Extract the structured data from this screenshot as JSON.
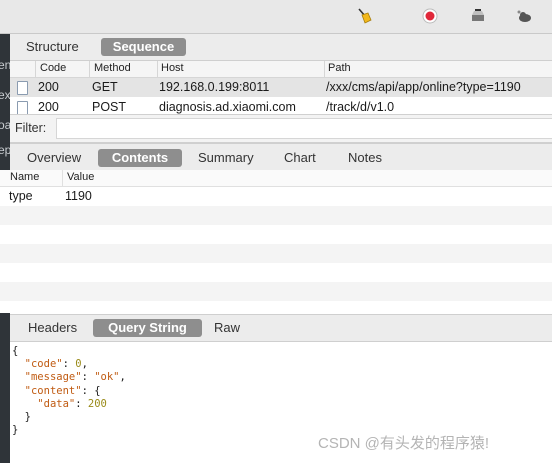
{
  "left_fragments": [
    "en",
    "ex",
    "oa",
    "ep",
    "e"
  ],
  "toolbar": {
    "icons": [
      "broom-icon",
      "record-icon",
      "throttle-icon",
      "settings-cloud-icon"
    ]
  },
  "view_tabs": {
    "items": [
      "Structure",
      "Sequence"
    ],
    "active": "Sequence"
  },
  "requests": {
    "columns": [
      "Code",
      "Method",
      "Host",
      "Path"
    ],
    "rows": [
      {
        "code": "200",
        "method": "GET",
        "host": "192.168.0.199:8011",
        "path": "/xxx/cms/api/app/online?type=1190"
      },
      {
        "code": "200",
        "method": "POST",
        "host": "diagnosis.ad.xiaomi.com",
        "path": "/track/d/v1.0"
      }
    ]
  },
  "filter": {
    "label": "Filter:",
    "value": ""
  },
  "detail_tabs": {
    "items": [
      "Overview",
      "Contents",
      "Summary",
      "Chart",
      "Notes"
    ],
    "active": "Contents"
  },
  "params": {
    "columns": [
      "Name",
      "Value"
    ],
    "rows": [
      {
        "name": "type",
        "value": "1190"
      }
    ]
  },
  "response_tabs": {
    "items": [
      "Headers",
      "Query String",
      "Raw"
    ],
    "active": "Query String"
  },
  "json_body": {
    "open": "{",
    "code_key": "\"code\"",
    "code_val": "0",
    "message_key": "\"message\"",
    "message_val": "\"ok\"",
    "content_key": "\"content\"",
    "content_open": "{",
    "data_key": "\"data\"",
    "data_val": "200",
    "content_close": "}",
    "close": "}"
  },
  "watermark": "CSDN @有头发的程序猿!"
}
